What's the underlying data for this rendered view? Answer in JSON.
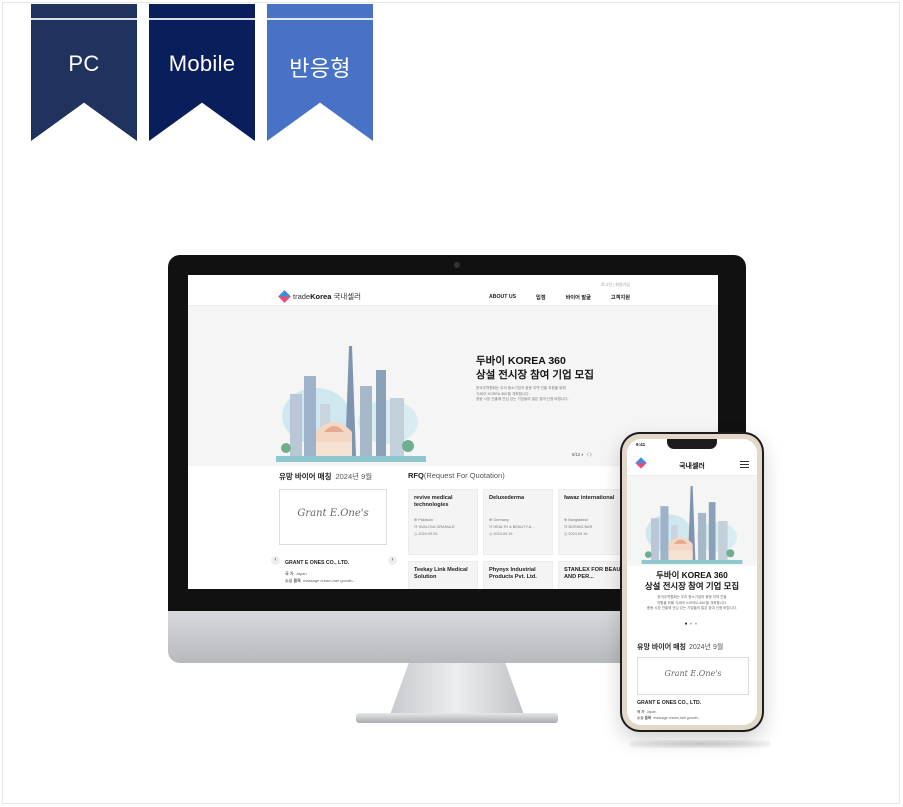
{
  "ribbons": [
    {
      "label": "PC",
      "color": "#20335f"
    },
    {
      "label": "Mobile",
      "color": "#0a1e5c"
    },
    {
      "label": "반응형",
      "color": "#4872c6"
    }
  ],
  "desktop": {
    "logo": {
      "brand_prefix": "trade",
      "brand_bold": "Korea",
      "brand_suffix": "국내셀러"
    },
    "util_links": "로그인 | 회원가입",
    "nav": [
      "ABOUT US",
      "입점",
      "바이어 발굴",
      "고객지원"
    ],
    "hero": {
      "title_line1": "두바이 KOREA 360",
      "title_line2": "상설 전시장 참여 기업 모집",
      "desc_line1": "한국무역협회는 우리 중소기업의 중동 지역 진출 지원을 위해",
      "desc_line2": "'두바이 KOREA 360'을 개최합니다.",
      "desc_line3": "중동 시장 진출에 관심 있는 기업들의 많은 참여 신청 바랍니다.",
      "pager": "8/12  ⏸  〈  〉"
    },
    "buyer_section": {
      "title": "유망 바이어 매칭",
      "period": "2024년 9월",
      "logo_text": "Grant E.One's",
      "company": "GRANT E ONES CO., LTD.",
      "country_label": "국   가",
      "country": "Japan",
      "interest_label": "소싱 품목",
      "interest": "massage cream,hair growth..."
    },
    "rfq": {
      "title": "RFQ",
      "subtitle": "(Request For Quotation)",
      "cards": [
        {
          "title": "revive medical technologies",
          "country": "Pakistan",
          "item": "SVALOVA GRANULE",
          "date": "2024.09.20."
        },
        {
          "title": "Deluxederma",
          "country": "Germany",
          "item": "HEALTH & BEAUTY,A...",
          "date": "2024.09.19."
        },
        {
          "title": "fawaz international",
          "country": "Bangladesh",
          "item": "BORING BAR",
          "date": "2024.09.16."
        }
      ],
      "cards_row2": [
        {
          "title": "Teekay Link Medical Solution"
        },
        {
          "title": "Phynyx Industrial Products Pvt. Ltd."
        },
        {
          "title": "STANLEX FOR BEAUTY AND PER..."
        }
      ]
    }
  },
  "mobile": {
    "time": "9:41",
    "title": "국내셀러",
    "hero_line1": "두바이 KOREA 360",
    "hero_line2": "상설 전시장 참여 기업 모집",
    "desc_line1": "한국무역협회는 우리 중소기업의 중동 지역 진출",
    "desc_line2": "지원을 위해 '두바이 KOREA 360'을 개최합니다.",
    "desc_line3": "중동 시장 진출에 관심 있는 기업들의 많은 참여 신청 바랍니다.",
    "buyer_title": "유망 바이어 매칭",
    "buyer_period": "2024년 9월",
    "logo_text": "Grant E.One's",
    "company": "GRANT E ONES CO., LTD.",
    "country_label": "국   가",
    "country": "Japan",
    "interest_label": "소싱 품목",
    "interest": "massage cream,hair growth..."
  }
}
